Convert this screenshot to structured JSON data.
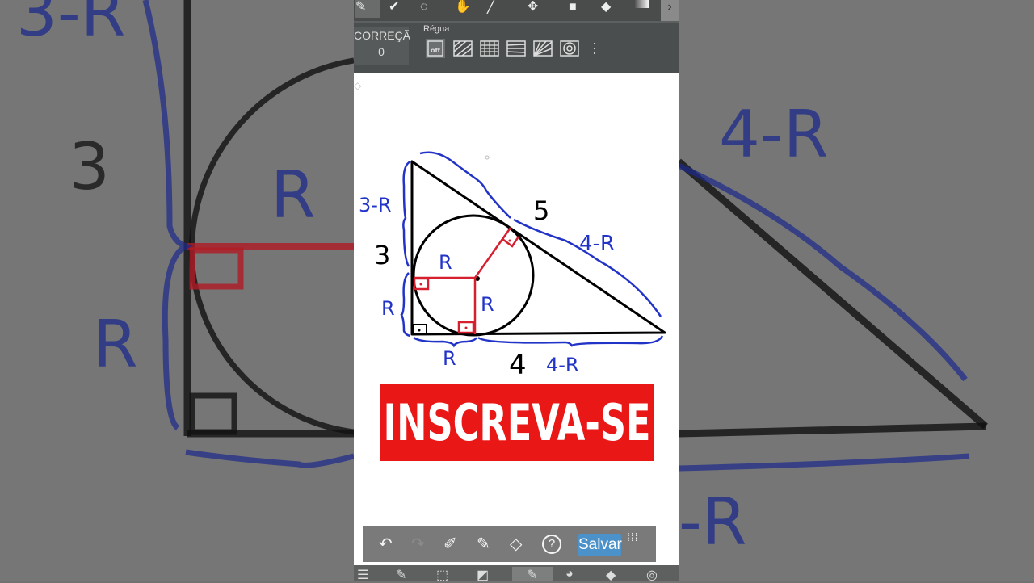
{
  "background": {
    "left_labels": [
      "3-R",
      "3",
      "R",
      "R"
    ],
    "right_labels": [
      "4-R",
      "-R"
    ]
  },
  "top_toolbar": {
    "tools": [
      "pen-tool",
      "fill-check-tool",
      "lasso-tool",
      "hand-tool",
      "line-tool",
      "move-tool",
      "shape-tool",
      "bucket-tool",
      "gradient-tool"
    ]
  },
  "sub_toolbar": {
    "correction_label": "CORREÇÃ",
    "correction_value": "0",
    "ruler_label": "Régua",
    "ruler_off": "off",
    "ruler_options": [
      "off",
      "parallel",
      "grid",
      "perspective",
      "radial",
      "concentric"
    ]
  },
  "drawing": {
    "labels": {
      "hyp": "5",
      "leg_vertical": "3",
      "leg_horizontal": "4",
      "top_segment": "3-R",
      "hyp_segment": "4-R",
      "bottom_segment": "4-R",
      "radius_h": "R",
      "radius_v": "R",
      "left_lower": "R",
      "bottom_left": "R"
    },
    "colors": {
      "black": "#000000",
      "blue": "#2233c8",
      "red": "#d62030"
    }
  },
  "banner": {
    "text": "INSCREVA-SE",
    "color": "#ea1717"
  },
  "bottom_toolbar": {
    "salvar_label": "Salvar"
  }
}
